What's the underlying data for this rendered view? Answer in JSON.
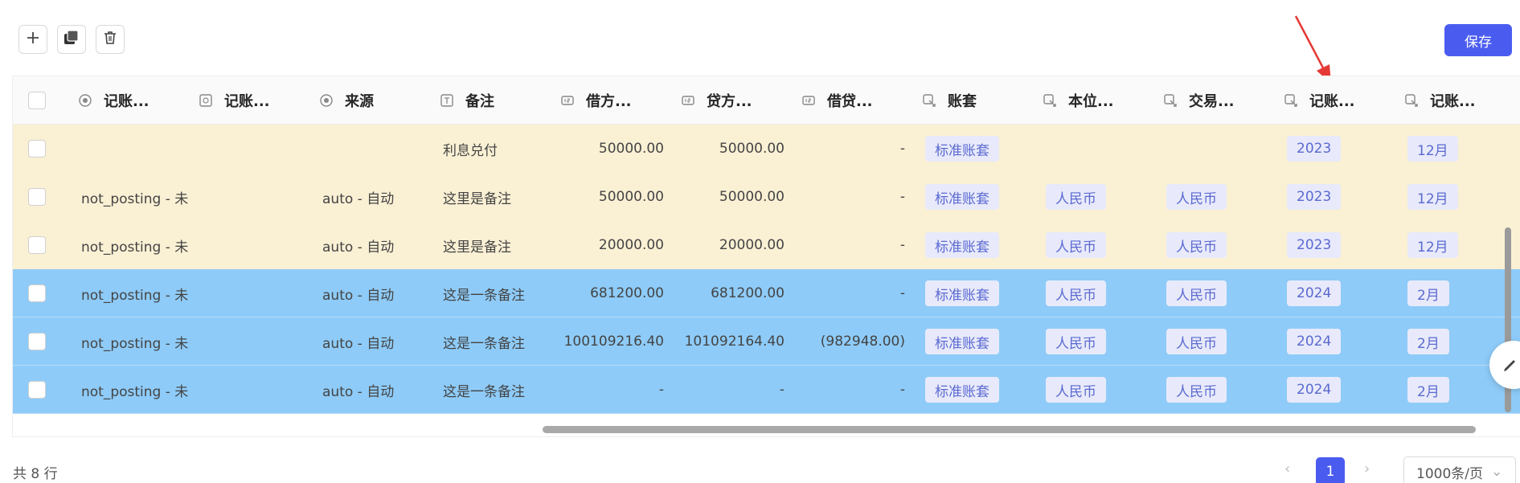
{
  "toolbar": {
    "icons": [
      "plus-icon",
      "copy-icon",
      "trash-icon"
    ],
    "save_label": "保存"
  },
  "columns": [
    {
      "label": "记账...",
      "icon": "radio-icon"
    },
    {
      "label": "记账...",
      "icon": "select-icon"
    },
    {
      "label": "来源",
      "icon": "radio-icon"
    },
    {
      "label": "备注",
      "icon": "text-icon"
    },
    {
      "label": "借方...",
      "icon": "number-icon"
    },
    {
      "label": "贷方...",
      "icon": "number-icon"
    },
    {
      "label": "借贷...",
      "icon": "number-icon"
    },
    {
      "label": "账套",
      "icon": "link-icon"
    },
    {
      "label": "本位...",
      "icon": "link-icon"
    },
    {
      "label": "交易...",
      "icon": "link-icon"
    },
    {
      "label": "记账...",
      "icon": "link-icon"
    },
    {
      "label": "记账...",
      "icon": "link-icon"
    }
  ],
  "rows": [
    {
      "status": "",
      "source": "",
      "note": "利息兑付",
      "debit": "50000.00",
      "credit": "50000.00",
      "diff": "-",
      "book": "标准账套",
      "base": "",
      "trade": "",
      "year": "2023",
      "month": "12月",
      "color": "#faf0d4"
    },
    {
      "status": "not_posting - 未",
      "source": "auto - 自动",
      "note": "这里是备注",
      "debit": "50000.00",
      "credit": "50000.00",
      "diff": "-",
      "book": "标准账套",
      "base": "人民币",
      "trade": "人民币",
      "year": "2023",
      "month": "12月",
      "color": "#faf0d4"
    },
    {
      "status": "not_posting - 未",
      "source": "auto - 自动",
      "note": "这里是备注",
      "debit": "20000.00",
      "credit": "20000.00",
      "diff": "-",
      "book": "标准账套",
      "base": "人民币",
      "trade": "人民币",
      "year": "2023",
      "month": "12月",
      "color": "#faf0d4"
    },
    {
      "status": "not_posting - 未",
      "source": "auto - 自动",
      "note": "这是一条备注",
      "debit": "681200.00",
      "credit": "681200.00",
      "diff": "-",
      "book": "标准账套",
      "base": "人民币",
      "trade": "人民币",
      "year": "2024",
      "month": "2月",
      "color": "#8ecbf8"
    },
    {
      "status": "not_posting - 未",
      "source": "auto - 自动",
      "note": "这是一条备注",
      "debit": "100109216.40",
      "credit": "101092164.40",
      "diff": "(982948.00)",
      "book": "标准账套",
      "base": "人民币",
      "trade": "人民币",
      "year": "2024",
      "month": "2月",
      "color": "#8ecbf8"
    },
    {
      "status": "not_posting - 未",
      "source": "auto - 自动",
      "note": "这是一条备注",
      "debit": "-",
      "credit": "-",
      "diff": "-",
      "book": "标准账套",
      "base": "人民币",
      "trade": "人民币",
      "year": "2024",
      "month": "2月",
      "color": "#8ecbf8"
    }
  ],
  "footer": {
    "total": "共 8 行",
    "current_page": "1",
    "page_size": "1000条/页"
  },
  "colors": {
    "accent": "#4a5cf0",
    "yellow_row": "#faf0d4",
    "blue_row": "#8ecbf8",
    "annotation_arrow": "#e53935"
  }
}
